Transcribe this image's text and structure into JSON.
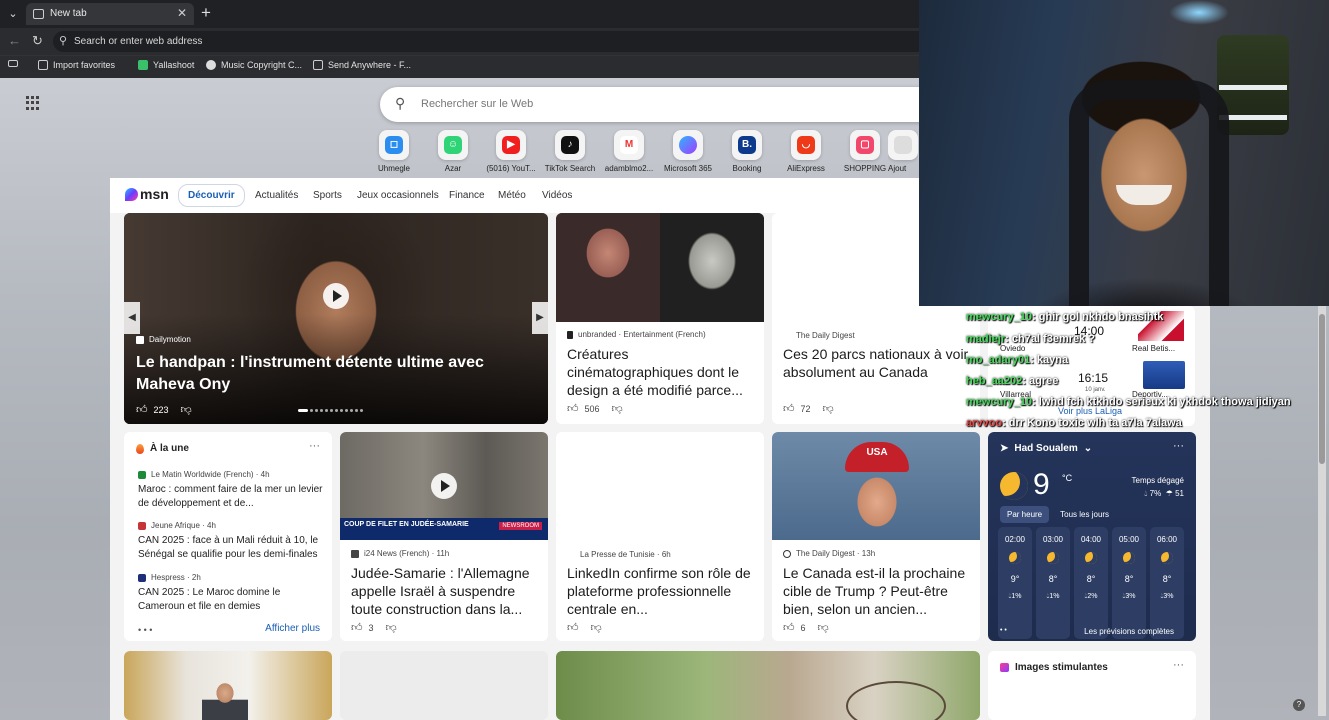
{
  "browser": {
    "tab_title": "New tab",
    "address_placeholder": "Search or enter web address",
    "favorites": [
      "Import favorites",
      "Yallashoot",
      "Music Copyright C...",
      "Send Anywhere - F..."
    ]
  },
  "search": {
    "placeholder": "Rechercher sur le Web"
  },
  "quick_links": [
    "Uhmegle",
    "Azar",
    "(5016) YouT...",
    "TikTok Search",
    "adamblmo2...",
    "Microsoft 365",
    "Booking",
    "AliExpress",
    "SHOPPING",
    "Ajout"
  ],
  "msn": {
    "logo": "msn",
    "nav": [
      "Découvrir",
      "Actualités",
      "Sports",
      "Jeux occasionnels",
      "Finance",
      "Météo",
      "Vidéos"
    ],
    "hero": {
      "source": "Dailymotion",
      "title": "Le handpan : l'instrument détente ultime avec Maheva Ony",
      "likes": "223"
    },
    "card_et": {
      "source": "unbranded · Entertainment (French)",
      "title": "Créatures cinématographiques dont le design a été modifié parce...",
      "likes": "506"
    },
    "card_parks": {
      "source": "The Daily Digest",
      "title": "Ces 20 parcs nationaux à voir absolument au Canada",
      "likes": "72"
    },
    "trending": {
      "header": "À la une",
      "more": "Afficher plus",
      "items": [
        {
          "source": "Le Matin Worldwide (French) · 4h",
          "title": "Maroc : comment faire de la mer un levier de développement et de..."
        },
        {
          "source": "Jeune Afrique · 4h",
          "title": "CAN 2025 : face à un Mali réduit à 10, le Sénégal se qualifie pour les demi-finales"
        },
        {
          "source": "Hespress · 2h",
          "title": "CAN 2025 : Le Maroc domine le Cameroun et file en demies"
        }
      ]
    },
    "card_i24": {
      "source": "i24 News (French) · 11h",
      "title": "Judée-Samarie : l'Allemagne appelle Israël à suspendre toute construction dans la...",
      "likes": "3",
      "image_caption": "COUP DE FILET EN JUDÉE-SAMARIE",
      "image_badge": "NEWSROOM"
    },
    "card_linkedin": {
      "source": "La Presse de Tunisie · 6h",
      "title": "LinkedIn confirme son rôle de plateforme professionnelle centrale en..."
    },
    "card_trump": {
      "source": "The Daily Digest · 13h",
      "title": "Le Canada est-il la prochaine cible de Trump ? Peut-être bien, selon un ancien...",
      "likes": "6",
      "cap_text": "USA"
    },
    "weather": {
      "location": "Had Soualem",
      "temp": "9",
      "unit": "°C",
      "condition": "Temps dégagé",
      "rain": "7%",
      "humidity": "51",
      "tab_hourly": "Par heure",
      "tab_daily": "Tous les jours",
      "hours": [
        {
          "time": "02:00",
          "temp": "9°",
          "rain": "1%"
        },
        {
          "time": "03:00",
          "temp": "8°",
          "rain": "1%"
        },
        {
          "time": "04:00",
          "temp": "8°",
          "rain": "2%"
        },
        {
          "time": "05:00",
          "temp": "8°",
          "rain": "3%"
        },
        {
          "time": "06:00",
          "temp": "8°",
          "rain": "3%"
        }
      ],
      "forecast_link": "Les prévisions complètes"
    },
    "images_card": {
      "header": "Images stimulantes"
    },
    "sports": {
      "match1": {
        "time": "14:00",
        "home": "Oviedo",
        "away": "Real Betis..."
      },
      "match2": {
        "time": "16:15",
        "date": "10 janv.",
        "home": "Villarreal",
        "away": "Deportiv..."
      },
      "link": "Voir plus LaLiga"
    }
  },
  "chat": [
    {
      "user": "mewcury_10",
      "msg": ": ghir gol nkhdo bnasihtk"
    },
    {
      "user": "madiejr",
      "msg": ": ch7al f3emrek ?"
    },
    {
      "user": "mo_adary01",
      "msg": ": kayna"
    },
    {
      "user": "heb_aa202",
      "msg": ": agree"
    },
    {
      "user": "mewcury_10",
      "msg": ": lwhd fch ktkhdo serieux ki ykhdok thowa jidiyan"
    },
    {
      "user": "arvvoo",
      "msg": ": drr Kono toxic wlh ta a7la 7alawa"
    }
  ]
}
